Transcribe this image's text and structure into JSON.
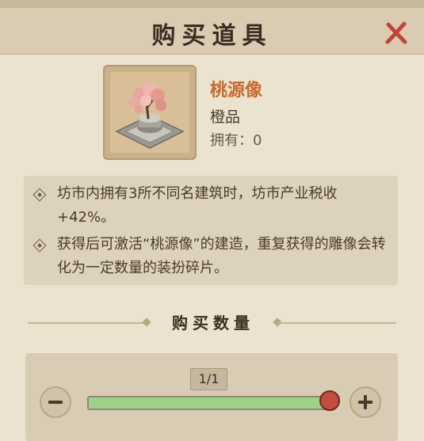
{
  "dialog": {
    "title": "购买道具",
    "close_icon": "close-x-icon",
    "accent_color": "#c8692a",
    "close_color": "#c0443a"
  },
  "item": {
    "name": "桃源像",
    "quality": "橙品",
    "owned": "拥有：0",
    "icon": "peach-blossom-statue-icon"
  },
  "description": [
    "坊市内拥有3所不同名建筑时，坊市产业税收+42%。",
    "获得后可激活“桃源像”的建造，重复获得的雕像会转化为一定数量的装扮碎片。"
  ],
  "quantity": {
    "section_title": "购买数量",
    "display": "1/1",
    "value": 1,
    "max": 1,
    "fill_fraction": 1.0,
    "slider_fill_color": "#9fd08a",
    "thumb_color": "#c24f3e"
  }
}
